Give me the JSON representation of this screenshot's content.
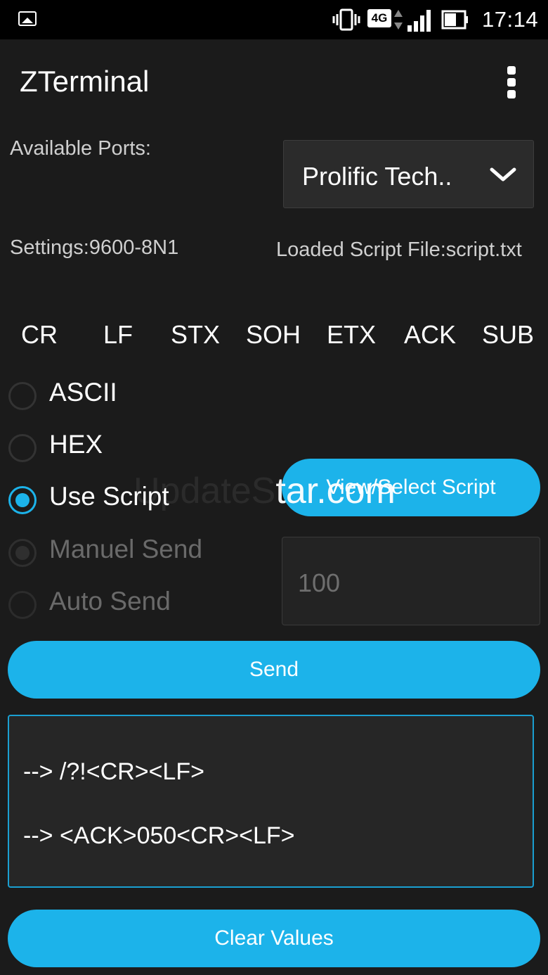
{
  "status_bar": {
    "network": "4G",
    "time": "17:14",
    "icons": [
      "gallery-icon",
      "vibrate-icon",
      "data-arrows-icon",
      "signal-icon",
      "battery-icon"
    ]
  },
  "app_bar": {
    "title": "ZTerminal",
    "overflow_icon": "more-vert-icon"
  },
  "ports": {
    "label": "Available Ports:",
    "selected": "Prolific Tech.."
  },
  "settings": {
    "label": "Settings:9600-8N1"
  },
  "script": {
    "label": "Loaded Script File:script.txt"
  },
  "control_chars": [
    "CR",
    "LF",
    "STX",
    "SOH",
    "ETX",
    "ACK",
    "SUB"
  ],
  "modes": [
    {
      "label": "ASCII",
      "checked": false,
      "enabled": true
    },
    {
      "label": "HEX",
      "checked": false,
      "enabled": true
    },
    {
      "label": "Use Script",
      "checked": true,
      "enabled": true
    },
    {
      "label": "Manuel Send",
      "checked": true,
      "enabled": false
    },
    {
      "label": "Auto Send",
      "checked": false,
      "enabled": false
    }
  ],
  "buttons": {
    "view_script": "View/Select Script",
    "send": "Send",
    "clear": "Clear Values"
  },
  "interval": {
    "placeholder": "100"
  },
  "log": [
    "--> /?!<CR><LF>",
    "--> <ACK>050<CR><LF>"
  ],
  "watermark": {
    "faint": "UpdateS",
    "strong": "tar.com"
  },
  "colors": {
    "accent": "#1cb3ea",
    "background": "#1b1b1b",
    "status_bar": "#000000"
  }
}
